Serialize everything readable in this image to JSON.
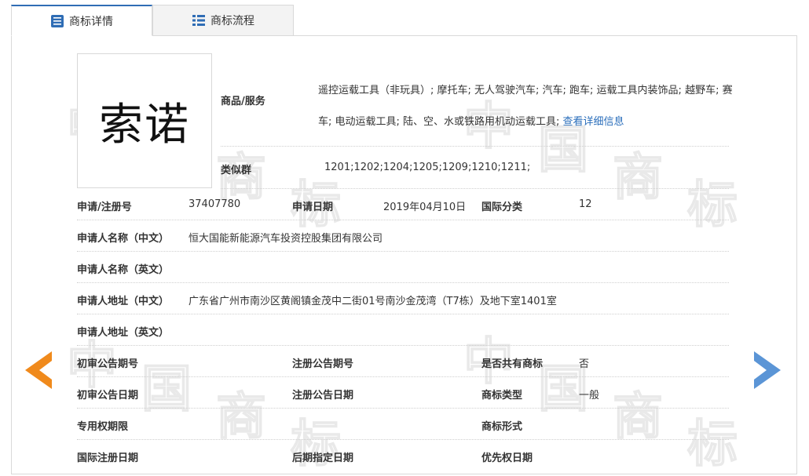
{
  "tabs": [
    {
      "label": "商标详情",
      "icon": "document-list-icon",
      "active": true
    },
    {
      "label": "商标流程",
      "icon": "flow-list-icon",
      "active": false
    }
  ],
  "watermark": [
    "中",
    "国",
    "商",
    "标"
  ],
  "trademark": {
    "image_text": "索诺",
    "goods_label": "商品/服务",
    "goods_text": "遥控运载工具（非玩具）; 摩托车; 无人驾驶汽车; 汽车; 跑车; 运载工具内装饰品; 越野车; 赛车; 电动运载工具; 陆、空、水或铁路用机动运载工具; ",
    "goods_link": "查看详细信息",
    "similar_label": "类似群",
    "similar_value": "1201;1202;1204;1205;1209;1210;1211;"
  },
  "rows": {
    "reg_no_label": "申请/注册号",
    "reg_no": "37407780",
    "apply_date_label": "申请日期",
    "apply_date": "2019年04月10日",
    "intl_class_label": "国际分类",
    "intl_class": "12",
    "applicant_cn_label": "申请人名称（中文）",
    "applicant_cn": "恒大国能新能源汽车投资控股集团有限公司",
    "applicant_en_label": "申请人名称（英文）",
    "address_cn_label": "申请人地址（中文）",
    "address_cn": "广东省广州市南沙区黄阁镇金茂中二街01号南沙金茂湾（T7栋）及地下室1401室",
    "address_en_label": "申请人地址（英文）",
    "prelim_pub_no_label": "初审公告期号",
    "reg_pub_no_label": "注册公告期号",
    "shared_label": "是否共有商标",
    "shared_value": "否",
    "prelim_pub_date_label": "初审公告日期",
    "reg_pub_date_label": "注册公告日期",
    "type_label": "商标类型",
    "type_value": "一般",
    "exclusive_label": "专用权期限",
    "form_label": "商标形式",
    "intl_reg_date_label": "国际注册日期",
    "later_date_label": "后期指定日期",
    "priority_date_label": "优先权日期"
  },
  "colors": {
    "accent": "#2f6db5",
    "link": "#2a6ebb",
    "prev_arrow": "#f08a1c",
    "next_arrow": "#5b95d6"
  }
}
